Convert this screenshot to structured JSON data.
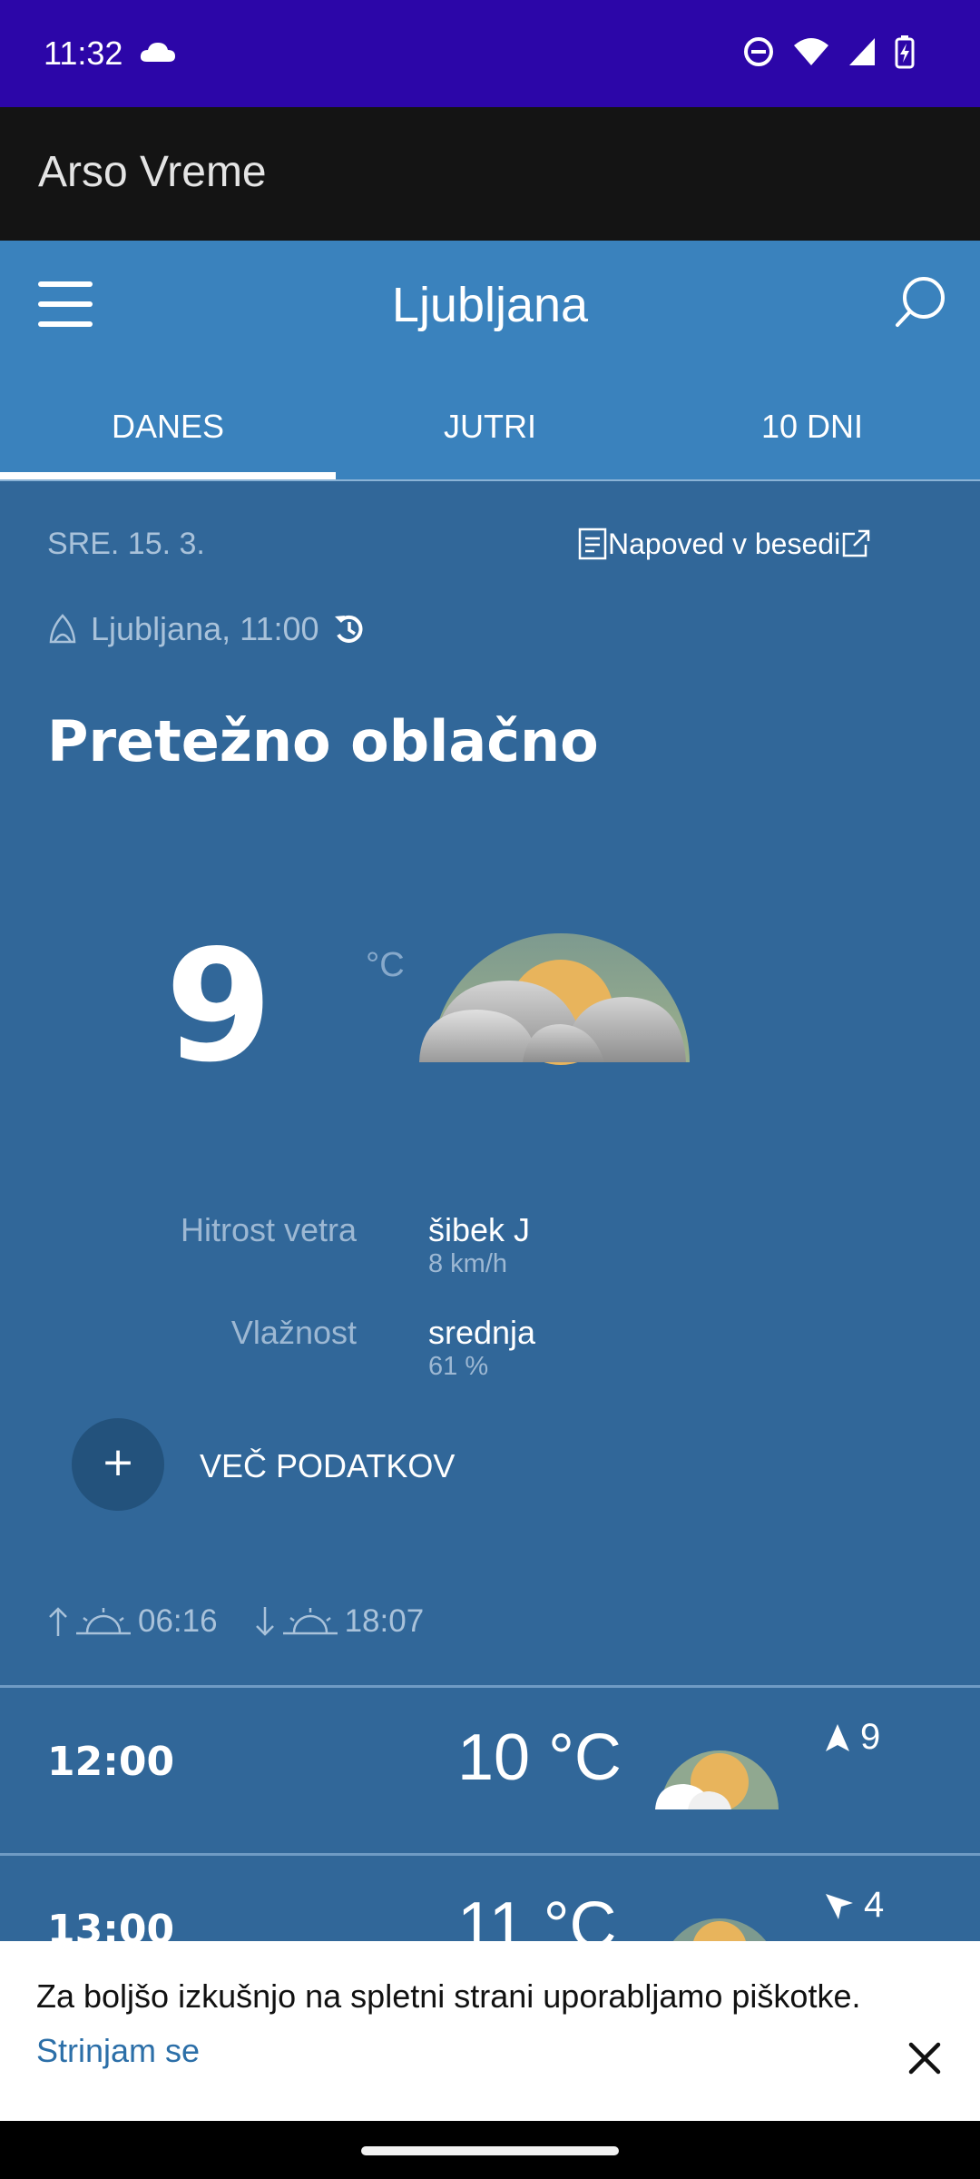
{
  "status_bar": {
    "time": "11:32"
  },
  "app_bar": {
    "title": "Arso Vreme"
  },
  "header": {
    "city": "Ljubljana"
  },
  "tabs": [
    {
      "label": "DANES",
      "active": true
    },
    {
      "label": "JUTRI",
      "active": false
    },
    {
      "label": "10 DNI",
      "active": false
    }
  ],
  "current": {
    "date": "SRE. 15. 3.",
    "forecast_link": "Napoved v besedi",
    "location": "Ljubljana, 11:00",
    "condition": "Pretežno oblačno",
    "temperature": "9",
    "unit": "°C",
    "icon": "mostly-cloudy-icon",
    "wind_label": "Hitrost vetra",
    "wind_value": "šibek J",
    "wind_speed": "8 km/h",
    "humidity_label": "Vlažnost",
    "humidity_value": "srednja",
    "humidity_percent": "61 %",
    "more_label": "VEČ PODATKOV",
    "sunrise": "06:16",
    "sunset": "18:07"
  },
  "hourly": [
    {
      "time": "12:00",
      "temp": "10 °C",
      "icon": "partly-cloudy-icon",
      "wind": "9"
    },
    {
      "time": "13:00",
      "temp": "11 °C",
      "icon": "mostly-cloudy-icon",
      "wind": "4"
    }
  ],
  "cookie": {
    "text": "Za boljšo izkušnjo na spletni strani uporabljamo piškotke.",
    "accept": "Strinjam se"
  },
  "colors": {
    "status_bar": "#2c06a8",
    "header": "#3a82bd",
    "main": "#316799",
    "link": "#2c6fa8"
  }
}
